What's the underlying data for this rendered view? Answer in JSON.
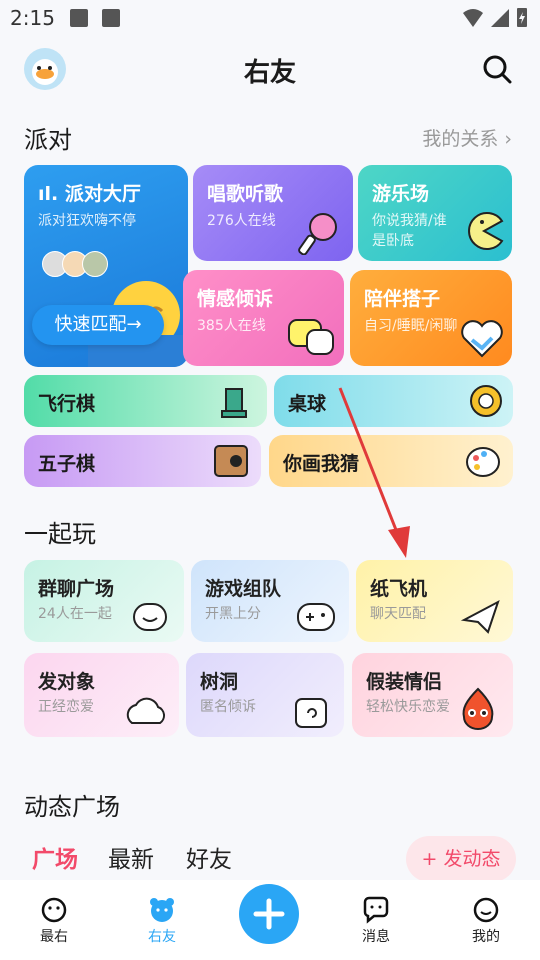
{
  "status": {
    "time": "2:15"
  },
  "header": {
    "title": "右友"
  },
  "party": {
    "title": "派对",
    "more": "我的关系",
    "big_card": {
      "title": "派对大厅",
      "subtitle": "派对狂欢嗨不停",
      "button": "快速匹配"
    },
    "cards": [
      {
        "title": "唱歌听歌",
        "subtitle": "276人在线"
      },
      {
        "title": "游乐场",
        "subtitle": "你说我猜/谁是卧底"
      },
      {
        "title": "情感倾诉",
        "subtitle": "385人在线"
      },
      {
        "title": "陪伴搭子",
        "subtitle": "自习/睡眠/闲聊"
      }
    ],
    "games": [
      {
        "title": "飞行棋"
      },
      {
        "title": "桌球"
      },
      {
        "title": "五子棋"
      },
      {
        "title": "你画我猜"
      }
    ]
  },
  "play": {
    "title": "一起玩",
    "cards": [
      {
        "title": "群聊广场",
        "subtitle": "24人在一起"
      },
      {
        "title": "游戏组队",
        "subtitle": "开黑上分"
      },
      {
        "title": "纸飞机",
        "subtitle": "聊天匹配"
      },
      {
        "title": "发对象",
        "subtitle": "正经恋爱"
      },
      {
        "title": "树洞",
        "subtitle": "匿名倾诉"
      },
      {
        "title": "假装情侣",
        "subtitle": "轻松快乐恋爱"
      }
    ]
  },
  "feed": {
    "title": "动态广场",
    "tabs": [
      "广场",
      "最新",
      "好友"
    ],
    "post_button": "+ 发动态"
  },
  "nav": {
    "items": [
      "最右",
      "右友",
      "消息",
      "我的"
    ]
  },
  "colors": {
    "accent": "#2aa6f5",
    "active_tab": "#f24a6a",
    "arrow": "#e03a3a"
  }
}
